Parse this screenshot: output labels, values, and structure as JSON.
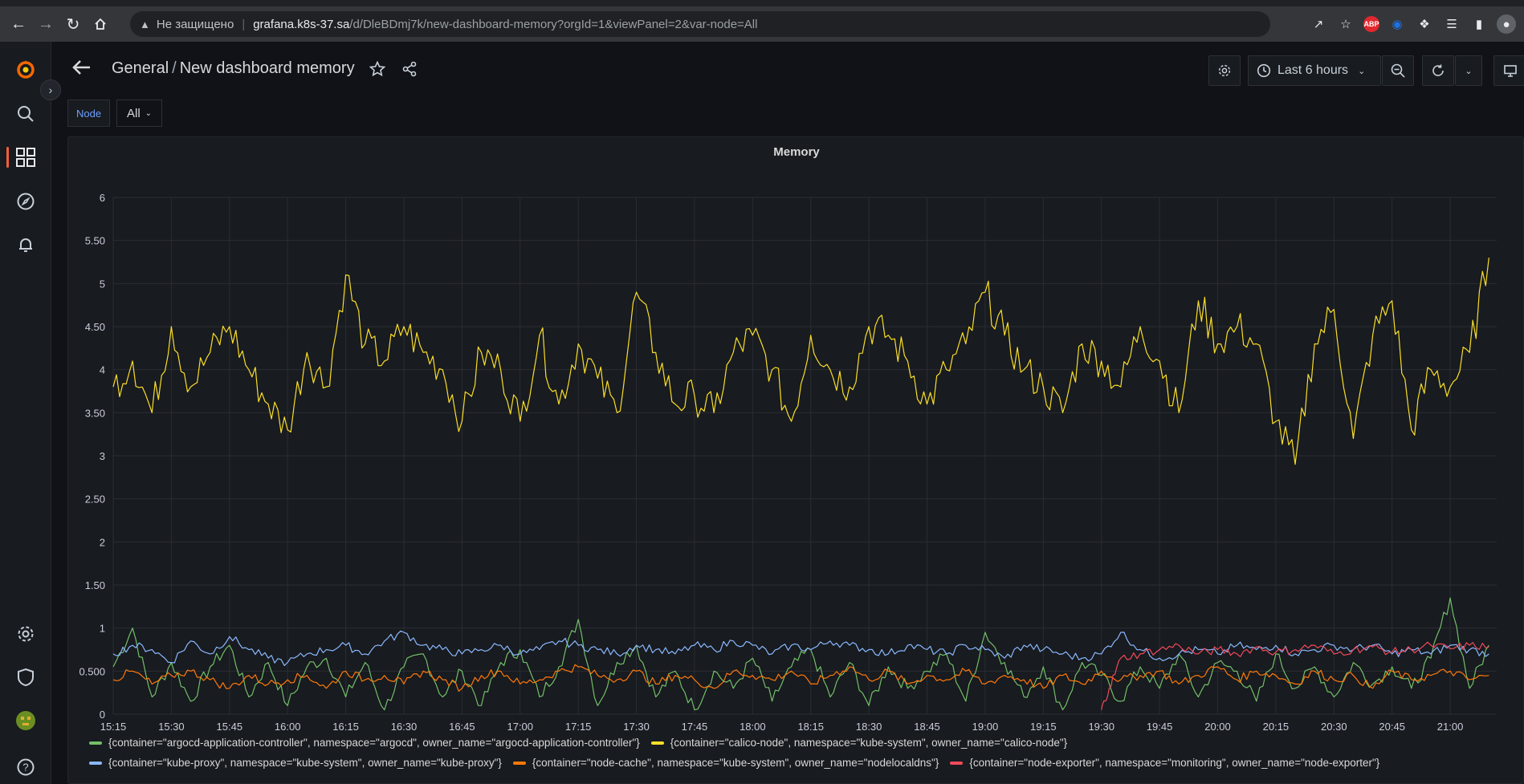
{
  "browser": {
    "not_secure": "Не защищено",
    "url_host": "grafana.k8s-37.sa",
    "url_path": "/d/DleBDmj7k/new-dashboard-memory?orgId=1&viewPanel=2&var-node=All",
    "ext_abp": "ABP"
  },
  "header": {
    "folder": "General",
    "separator": "/",
    "dashboard_title": "New dashboard memory",
    "time_range": "Last 6 hours"
  },
  "variables": {
    "node_label": "Node",
    "node_value": "All"
  },
  "panel": {
    "title": "Memory"
  },
  "colors": {
    "green": "#73bf69",
    "yellow": "#fade2a",
    "blue": "#8ab8ff",
    "orange": "#ff780a",
    "red": "#f2495c"
  },
  "chart_data": {
    "type": "line",
    "title": "Memory",
    "ylim": [
      0,
      6
    ],
    "y_ticks": [
      "0",
      "0.500",
      "1",
      "1.50",
      "2",
      "2.50",
      "3",
      "3.50",
      "4",
      "4.50",
      "5",
      "5.50",
      "6"
    ],
    "x_ticks": [
      "15:15",
      "15:30",
      "15:45",
      "16:00",
      "16:15",
      "16:30",
      "16:45",
      "17:00",
      "17:15",
      "17:30",
      "17:45",
      "18:00",
      "18:15",
      "18:30",
      "18:45",
      "19:00",
      "19:15",
      "19:30",
      "19:45",
      "20:00",
      "20:15",
      "20:30",
      "20:45",
      "21:00"
    ],
    "x_start": "15:15",
    "x_end": "21:12",
    "grid": true,
    "legend_placement": "bottom",
    "series": [
      {
        "name": "{container=\"argocd-application-controller\", namespace=\"argocd\", owner_name=\"argocd-application-controller\"}",
        "color": "#73bf69",
        "times": [
          "15:15",
          "15:20",
          "15:25",
          "15:30",
          "15:35",
          "15:40",
          "15:45",
          "15:50",
          "15:55",
          "16:00",
          "16:05",
          "16:10",
          "16:15",
          "16:20",
          "16:25",
          "16:30",
          "16:35",
          "16:40",
          "16:45",
          "16:50",
          "16:55",
          "17:00",
          "17:05",
          "17:10",
          "17:15",
          "17:20",
          "17:25",
          "17:30",
          "17:35",
          "17:40",
          "17:45",
          "17:50",
          "17:55",
          "18:00",
          "18:05",
          "18:10",
          "18:15",
          "18:20",
          "18:25",
          "18:30",
          "18:35",
          "18:40",
          "18:45",
          "18:50",
          "18:55",
          "19:00",
          "19:05",
          "19:10",
          "19:15",
          "19:20",
          "19:25",
          "19:30",
          "19:35",
          "19:40",
          "19:45",
          "19:50",
          "19:55",
          "20:00",
          "20:05",
          "20:10",
          "20:15",
          "20:20",
          "20:25",
          "20:30",
          "20:35",
          "20:40",
          "20:45",
          "20:50",
          "20:55",
          "21:00",
          "21:05",
          "21:10"
        ],
        "values": [
          0.55,
          1.0,
          0.2,
          0.6,
          0.15,
          0.55,
          0.8,
          0.2,
          0.6,
          0.1,
          0.55,
          0.65,
          0.2,
          0.6,
          0.05,
          0.55,
          0.7,
          0.2,
          0.5,
          0.1,
          0.6,
          0.75,
          0.2,
          0.55,
          1.1,
          0.1,
          0.6,
          0.8,
          0.2,
          0.5,
          0.05,
          0.5,
          0.3,
          0.65,
          0.15,
          0.55,
          0.75,
          0.2,
          0.6,
          0.1,
          0.55,
          0.3,
          0.5,
          0.7,
          0.15,
          0.95,
          0.6,
          0.2,
          0.55,
          0.05,
          0.6,
          0.45,
          0.15,
          0.55,
          0.3,
          0.7,
          0.2,
          0.6,
          0.5,
          0.15,
          0.7,
          0.3,
          0.55,
          0.2,
          0.6,
          0.35,
          0.55,
          0.3,
          0.65,
          1.35,
          0.3,
          0.8
        ]
      },
      {
        "name": "{container=\"calico-node\", namespace=\"kube-system\", owner_name=\"calico-node\"}",
        "color": "#fade2a",
        "times": [
          "15:15",
          "15:20",
          "15:25",
          "15:30",
          "15:35",
          "15:40",
          "15:45",
          "15:50",
          "15:55",
          "16:00",
          "16:05",
          "16:10",
          "16:15",
          "16:20",
          "16:25",
          "16:30",
          "16:35",
          "16:40",
          "16:45",
          "16:50",
          "16:55",
          "17:00",
          "17:05",
          "17:10",
          "17:15",
          "17:20",
          "17:25",
          "17:30",
          "17:35",
          "17:40",
          "17:45",
          "17:50",
          "17:55",
          "18:00",
          "18:05",
          "18:10",
          "18:15",
          "18:20",
          "18:25",
          "18:30",
          "18:35",
          "18:40",
          "18:45",
          "18:50",
          "18:55",
          "19:00",
          "19:05",
          "19:10",
          "19:15",
          "19:20",
          "19:25",
          "19:30",
          "19:35",
          "19:40",
          "19:45",
          "19:50",
          "19:55",
          "20:00",
          "20:05",
          "20:10",
          "20:15",
          "20:20",
          "20:25",
          "20:30",
          "20:35",
          "20:40",
          "20:45",
          "20:50",
          "20:55",
          "21:00",
          "21:05",
          "21:10"
        ],
        "values": [
          3.8,
          4.1,
          3.5,
          4.5,
          3.8,
          4.2,
          4.5,
          4.0,
          3.6,
          3.3,
          4.2,
          3.8,
          5.1,
          4.3,
          4.1,
          4.5,
          4.2,
          4.0,
          3.4,
          4.2,
          4.0,
          3.4,
          4.4,
          3.6,
          4.3,
          3.9,
          3.5,
          4.9,
          4.2,
          3.6,
          3.7,
          3.5,
          4.2,
          4.4,
          4.0,
          3.4,
          4.4,
          4.0,
          3.8,
          4.5,
          4.4,
          4.1,
          3.6,
          4.0,
          4.3,
          4.9,
          4.4,
          4.0,
          3.8,
          3.5,
          4.3,
          4.1,
          3.8,
          4.5,
          4.1,
          3.5,
          4.8,
          4.3,
          4.5,
          4.3,
          3.4,
          2.9,
          4.3,
          4.7,
          3.2,
          4.4,
          4.8,
          3.3,
          4.0,
          3.8,
          4.2,
          5.3
        ]
      },
      {
        "name": "{container=\"kube-proxy\", namespace=\"kube-system\", owner_name=\"kube-proxy\"}",
        "color": "#8ab8ff",
        "times": [
          "15:15",
          "15:20",
          "15:25",
          "15:30",
          "15:35",
          "15:40",
          "15:45",
          "15:50",
          "15:55",
          "16:00",
          "16:05",
          "16:10",
          "16:15",
          "16:20",
          "16:25",
          "16:30",
          "16:35",
          "16:40",
          "16:45",
          "16:50",
          "16:55",
          "17:00",
          "17:05",
          "17:10",
          "17:15",
          "17:20",
          "17:25",
          "17:30",
          "17:35",
          "17:40",
          "17:45",
          "17:50",
          "17:55",
          "18:00",
          "18:05",
          "18:10",
          "18:15",
          "18:20",
          "18:25",
          "18:30",
          "18:35",
          "18:40",
          "18:45",
          "18:50",
          "18:55",
          "19:00",
          "19:05",
          "19:10",
          "19:15",
          "19:20",
          "19:25",
          "19:30",
          "19:35",
          "19:40",
          "19:45",
          "19:50",
          "19:55",
          "20:00",
          "20:05",
          "20:10",
          "20:15",
          "20:20",
          "20:25",
          "20:30",
          "20:35",
          "20:40",
          "20:45",
          "20:50",
          "20:55",
          "21:00",
          "21:05",
          "21:10"
        ],
        "values": [
          0.7,
          0.8,
          0.75,
          0.6,
          0.85,
          0.7,
          0.9,
          0.75,
          0.65,
          0.6,
          0.7,
          0.75,
          0.8,
          0.7,
          0.85,
          0.95,
          0.8,
          0.75,
          0.7,
          0.75,
          0.8,
          0.7,
          0.75,
          0.85,
          0.8,
          0.75,
          0.7,
          0.8,
          0.75,
          0.7,
          0.8,
          0.75,
          0.85,
          0.8,
          0.7,
          0.8,
          0.75,
          0.85,
          0.8,
          0.75,
          0.7,
          0.8,
          0.75,
          0.7,
          0.8,
          0.75,
          0.65,
          0.8,
          0.75,
          0.7,
          0.65,
          0.7,
          0.95,
          0.75,
          0.65,
          0.7,
          0.75,
          0.7,
          0.8,
          0.75,
          0.8,
          0.7,
          0.75,
          0.8,
          0.75,
          0.8,
          0.7,
          0.75,
          0.7,
          0.8,
          0.75,
          0.7
        ]
      },
      {
        "name": "{container=\"node-cache\", namespace=\"kube-system\", owner_name=\"nodelocaldns\"}",
        "color": "#ff780a",
        "times": [
          "15:15",
          "15:20",
          "15:25",
          "15:30",
          "15:35",
          "15:40",
          "15:45",
          "15:50",
          "15:55",
          "16:00",
          "16:05",
          "16:10",
          "16:15",
          "16:20",
          "16:25",
          "16:30",
          "16:35",
          "16:40",
          "16:45",
          "16:50",
          "16:55",
          "17:00",
          "17:05",
          "17:10",
          "17:15",
          "17:20",
          "17:25",
          "17:30",
          "17:35",
          "17:40",
          "17:45",
          "17:50",
          "17:55",
          "18:00",
          "18:05",
          "18:10",
          "18:15",
          "18:20",
          "18:25",
          "18:30",
          "18:35",
          "18:40",
          "18:45",
          "18:50",
          "18:55",
          "19:00",
          "19:05",
          "19:10",
          "19:15",
          "19:20",
          "19:25",
          "19:30",
          "19:35",
          "19:40",
          "19:45",
          "19:50",
          "19:55",
          "20:00",
          "20:05",
          "20:10",
          "20:15",
          "20:20",
          "20:25",
          "20:30",
          "20:35",
          "20:40",
          "20:45",
          "20:50",
          "20:55",
          "21:00",
          "21:05",
          "21:10"
        ],
        "values": [
          0.4,
          0.5,
          0.35,
          0.45,
          0.5,
          0.4,
          0.3,
          0.45,
          0.35,
          0.4,
          0.45,
          0.3,
          0.5,
          0.4,
          0.45,
          0.35,
          0.5,
          0.4,
          0.3,
          0.45,
          0.5,
          0.35,
          0.4,
          0.5,
          0.55,
          0.45,
          0.4,
          0.5,
          0.35,
          0.45,
          0.4,
          0.3,
          0.5,
          0.45,
          0.4,
          0.5,
          0.35,
          0.45,
          0.55,
          0.4,
          0.5,
          0.35,
          0.45,
          0.4,
          0.5,
          0.35,
          0.45,
          0.4,
          0.3,
          0.45,
          0.35,
          0.5,
          0.4,
          0.45,
          0.5,
          0.35,
          0.45,
          0.55,
          0.4,
          0.5,
          0.45,
          0.35,
          0.5,
          0.4,
          0.45,
          0.3,
          0.5,
          0.4,
          0.45,
          0.5,
          0.4,
          0.45
        ]
      },
      {
        "name": "{container=\"node-exporter\", namespace=\"monitoring\", owner_name=\"node-exporter\"}",
        "color": "#f2495c",
        "times": [
          "19:30",
          "19:32",
          "19:35",
          "19:40",
          "19:45",
          "19:50",
          "19:55",
          "20:00",
          "20:05",
          "20:10",
          "20:15",
          "20:20",
          "20:25",
          "20:30",
          "20:35",
          "20:40",
          "20:45",
          "20:50",
          "20:55",
          "21:00",
          "21:05",
          "21:10"
        ],
        "values": [
          0.05,
          0.3,
          0.65,
          0.7,
          0.75,
          0.8,
          0.7,
          0.75,
          0.7,
          0.78,
          0.72,
          0.75,
          0.8,
          0.7,
          0.75,
          0.78,
          0.72,
          0.75,
          0.8,
          0.76,
          0.8,
          0.78
        ]
      }
    ]
  }
}
